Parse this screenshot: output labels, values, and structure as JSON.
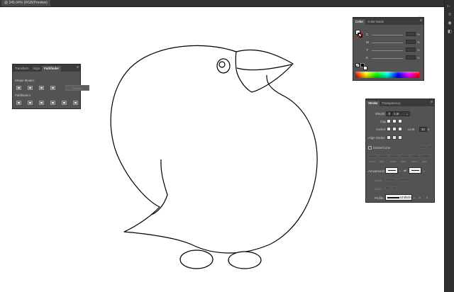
{
  "document": {
    "tab_title": "@ 245.04% (RGB/Preview)",
    "close_glyph": "×"
  },
  "right_dock": {
    "label": "Pr"
  },
  "pathfinder_panel": {
    "tabs": [
      "Transform",
      "Align",
      "Pathfinder"
    ],
    "active_tab": "Pathfinder",
    "shape_modes_label": "Shape Modes:",
    "pathfinders_label": "Pathfinders:",
    "expand_label": "Expand",
    "shape_mode_icons": [
      "unite-icon",
      "minus-front-icon",
      "intersect-icon",
      "exclude-icon"
    ],
    "pathfinder_icons": [
      "divide-icon",
      "trim-icon",
      "merge-icon",
      "crop-icon",
      "outline-icon",
      "minus-back-icon"
    ]
  },
  "color_panel": {
    "tabs": [
      "Color",
      "Color Guide"
    ],
    "active_tab": "Color",
    "channels": [
      {
        "label": "C",
        "unit": "%"
      },
      {
        "label": "M",
        "unit": "%"
      },
      {
        "label": "Y",
        "unit": "%"
      },
      {
        "label": "K",
        "unit": "%"
      }
    ]
  },
  "stroke_panel": {
    "tabs": [
      "Stroke",
      "Transparency"
    ],
    "active_tab": "Stroke",
    "weight_label": "Weight:",
    "weight_value": "1 pt",
    "cap_label": "Cap:",
    "corner_label": "Corner:",
    "limit_label": "Limit:",
    "limit_value": "10",
    "align_label": "Align Stroke:",
    "dashed_label": "Dashed Line",
    "dash_labels": [
      "dash",
      "gap",
      "dash",
      "gap",
      "dash",
      "gap"
    ],
    "arrowheads_label": "Arrowheads:",
    "scale_label": "Scale:",
    "align_arrow_label": "Align:",
    "profile_label": "Profile:",
    "profile_value": "Uniform"
  },
  "colors": {
    "ui_dark": "#323232",
    "panel_bg": "#535353",
    "canvas": "#ffffff",
    "stroke": "#000000"
  }
}
